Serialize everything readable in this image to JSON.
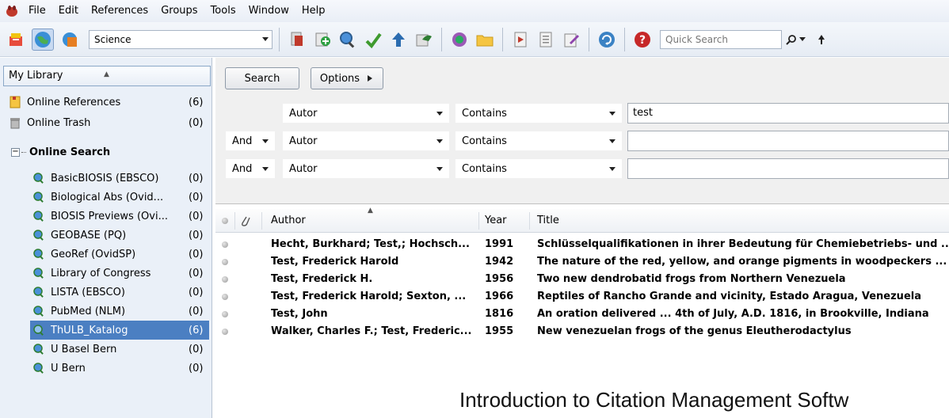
{
  "menu": [
    "File",
    "Edit",
    "References",
    "Groups",
    "Tools",
    "Window",
    "Help"
  ],
  "toolbar": {
    "output_style": "Science",
    "quick_search_placeholder": "Quick Search",
    "icons": [
      "local-library-icon",
      "online-search-mode-icon",
      "integrated-library-icon",
      "insert-citation-icon",
      "new-reference-icon",
      "online-search-icon",
      "import-icon",
      "export-icon",
      "open-link-icon",
      "find-full-text-icon",
      "open-file-icon",
      "insert-citation-word-icon",
      "format-bibliography-icon",
      "edit-citation-icon",
      "sync-icon",
      "help-icon"
    ]
  },
  "sidebar": {
    "header": "My Library",
    "items": [
      {
        "label": "Online References",
        "count": "(6)",
        "icon": "folder-icon"
      },
      {
        "label": "Online Trash",
        "count": "(0)",
        "icon": "trash-icon"
      }
    ],
    "online_search_label": "Online Search",
    "online_search_expander": "−",
    "sources": [
      {
        "label": "BasicBIOSIS (EBSCO)",
        "count": "(0)"
      },
      {
        "label": "Biological Abs (Ovid...",
        "count": "(0)"
      },
      {
        "label": "BIOSIS Previews (Ovi...",
        "count": "(0)"
      },
      {
        "label": "GEOBASE (PQ)",
        "count": "(0)"
      },
      {
        "label": "GeoRef (OvidSP)",
        "count": "(0)"
      },
      {
        "label": "Library of Congress",
        "count": "(0)"
      },
      {
        "label": "LISTA (EBSCO)",
        "count": "(0)"
      },
      {
        "label": "PubMed (NLM)",
        "count": "(0)"
      },
      {
        "label": "ThULB_Katalog",
        "count": "(6)",
        "selected": true
      },
      {
        "label": "U Basel Bern",
        "count": "(0)"
      },
      {
        "label": "U Bern",
        "count": "(0)"
      }
    ]
  },
  "search": {
    "search_button": "Search",
    "options_button": "Options",
    "rows": [
      {
        "bool": "",
        "field": "Autor",
        "operator": "Contains",
        "value": "test"
      },
      {
        "bool": "And",
        "field": "Autor",
        "operator": "Contains",
        "value": ""
      },
      {
        "bool": "And",
        "field": "Autor",
        "operator": "Contains",
        "value": ""
      }
    ]
  },
  "results": {
    "columns": {
      "author": "Author",
      "year": "Year",
      "title": "Title"
    },
    "rows": [
      {
        "author": "Hecht, Burkhard; Test,; Hochsch...",
        "year": "1991",
        "title": "Schlüsselqualifikationen in ihrer Bedeutung für Chemiebetriebs- und ..."
      },
      {
        "author": "Test, Frederick Harold",
        "year": "1942",
        "title": "The nature of the red, yellow, and orange pigments in woodpeckers ..."
      },
      {
        "author": "Test, Frederick H.",
        "year": "1956",
        "title": "Two new dendrobatid frogs from Northern Venezuela"
      },
      {
        "author": "Test, Frederick Harold; Sexton, ...",
        "year": "1966",
        "title": "Reptiles of Rancho Grande and vicinity, Estado Aragua, Venezuela"
      },
      {
        "author": "Test, John",
        "year": "1816",
        "title": "An oration delivered ... 4th of July, A.D. 1816, in Brookville, Indiana"
      },
      {
        "author": "Walker, Charles F.; Test, Frederic...",
        "year": "1955",
        "title": "New venezuelan frogs of the genus Eleutherodactylus"
      }
    ]
  },
  "slide_title": "Introduction to Citation Management Softw"
}
